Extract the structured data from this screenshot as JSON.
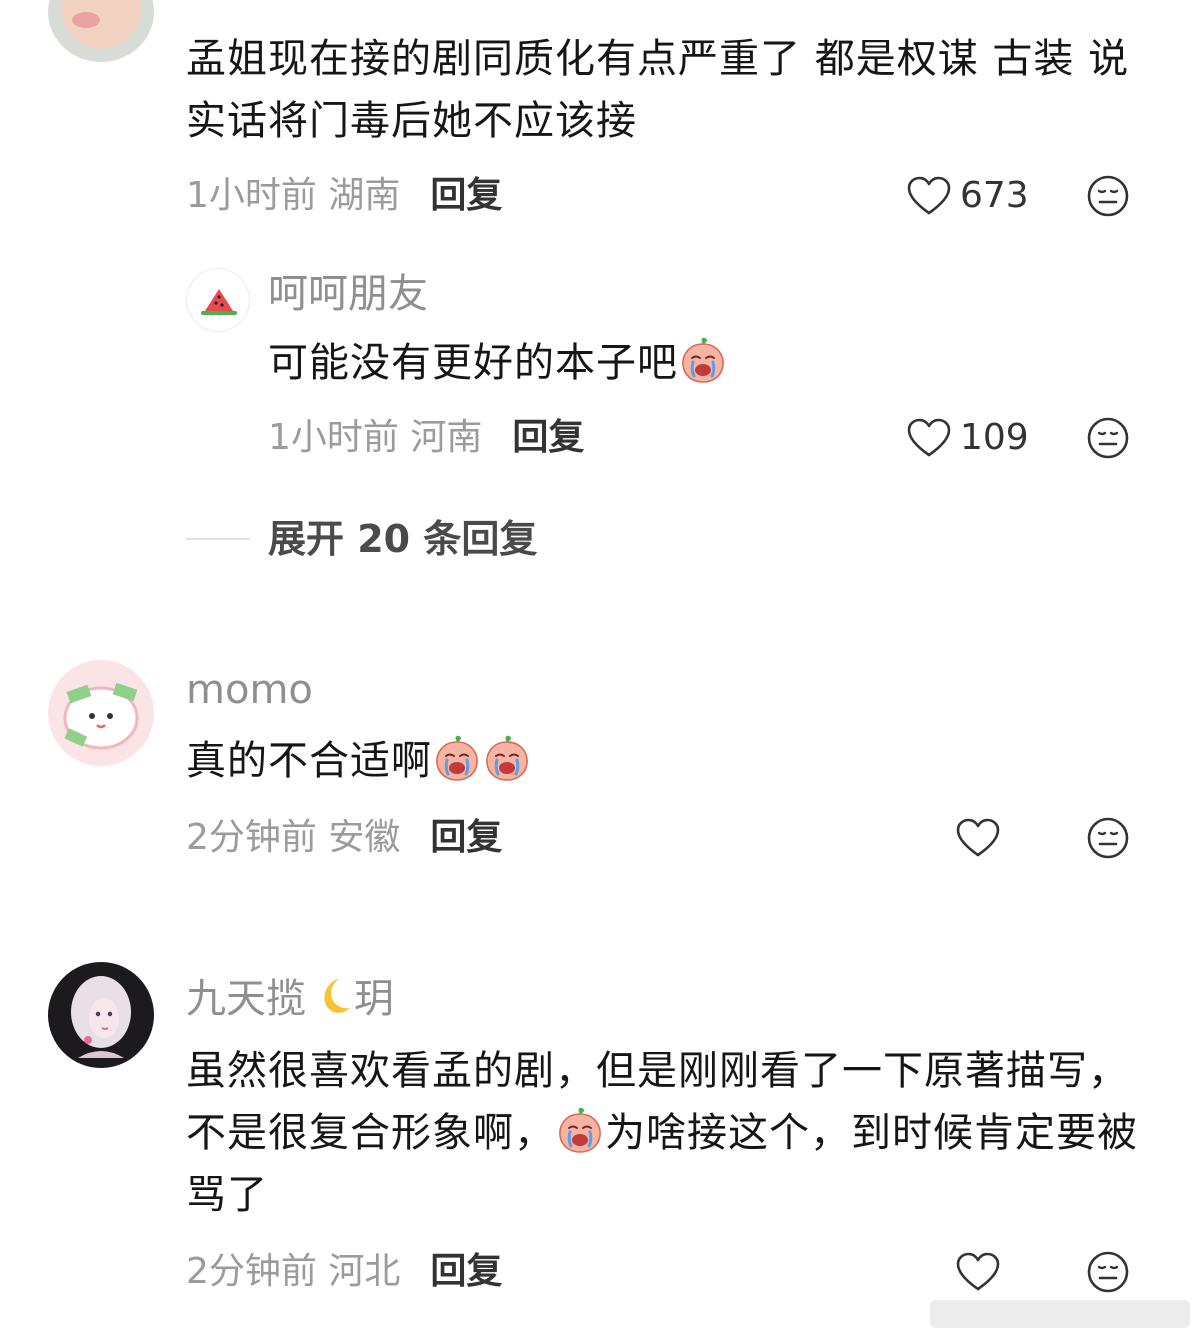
{
  "comments": [
    {
      "text": "孟姐现在接的剧同质化有点严重了 都是权谋 古装 说实话将门毒后她不应该接",
      "time": "1小时前 湖南",
      "reply": "回复",
      "likes": "673",
      "replies": [
        {
          "name": "呵呵朋友",
          "text": "可能没有更好的本子吧",
          "emoji": "crying-peach-emoji",
          "time": "1小时前 河南",
          "reply": "回复",
          "likes": "109"
        }
      ],
      "expand": "展开 20 条回复"
    },
    {
      "name": "momo",
      "text": "真的不合适啊",
      "emoji": "crying-peach-emoji",
      "time": "2分钟前 安徽",
      "reply": "回复"
    },
    {
      "name_before": "九天揽",
      "name_emoji": "crescent-moon-icon",
      "name_after": "玥",
      "text_part1": "虽然很喜欢看孟的剧，但是刚刚看了一下原著描写，不是很复合形象啊，",
      "text_emoji": "crying-peach-emoji",
      "text_part2": "为啥接这个，到时候肯定要被骂了",
      "time": "2分钟前 河北",
      "reply": "回复"
    }
  ],
  "colors": {
    "name": "#8f8f8f",
    "text": "#161616",
    "meta": "#9b9b9b",
    "action": "#333333"
  },
  "icons": [
    "heart-outline-icon",
    "neutral-face-icon"
  ]
}
